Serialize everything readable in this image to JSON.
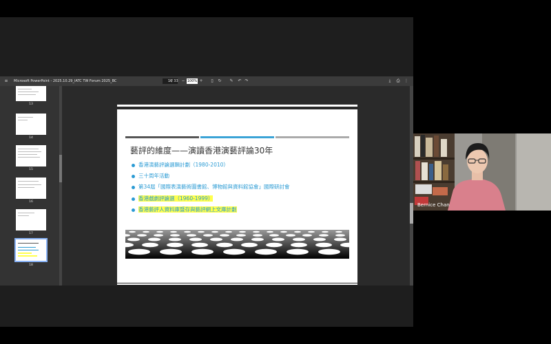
{
  "viewer": {
    "title": "Microsoft PowerPoint - 2025.10.29_IATC TW Forum 2025_BC",
    "page_current": "16",
    "page_total": "/ 33",
    "zoom": "100%"
  },
  "thumbnails": [
    {
      "number": "13"
    },
    {
      "number": "14"
    },
    {
      "number": "15"
    },
    {
      "number": "16"
    },
    {
      "number": "17"
    },
    {
      "number": "18"
    }
  ],
  "slide": {
    "title": "藝評的維度——演讀香港演藝評論30年",
    "bullets": [
      {
        "text": "香港演藝評論選輯計劃（1980-2010）",
        "highlight": false
      },
      {
        "text": "三十周年活動",
        "highlight": false
      },
      {
        "text": "第34屆「國際表演藝術圖書館、博物館與資料館協會」國際研討會",
        "highlight": false
      },
      {
        "text": "香港戲劇評論選（1960-1999）",
        "highlight": true
      },
      {
        "text": "香港藝評人資料庫暨存與藝評網上文庫計劃",
        "highlight": true
      }
    ],
    "title_bar_colors": [
      "#555555",
      "#3aa3d6",
      "#aaaaaa"
    ]
  },
  "participant": {
    "name": "Bernice Chan"
  }
}
